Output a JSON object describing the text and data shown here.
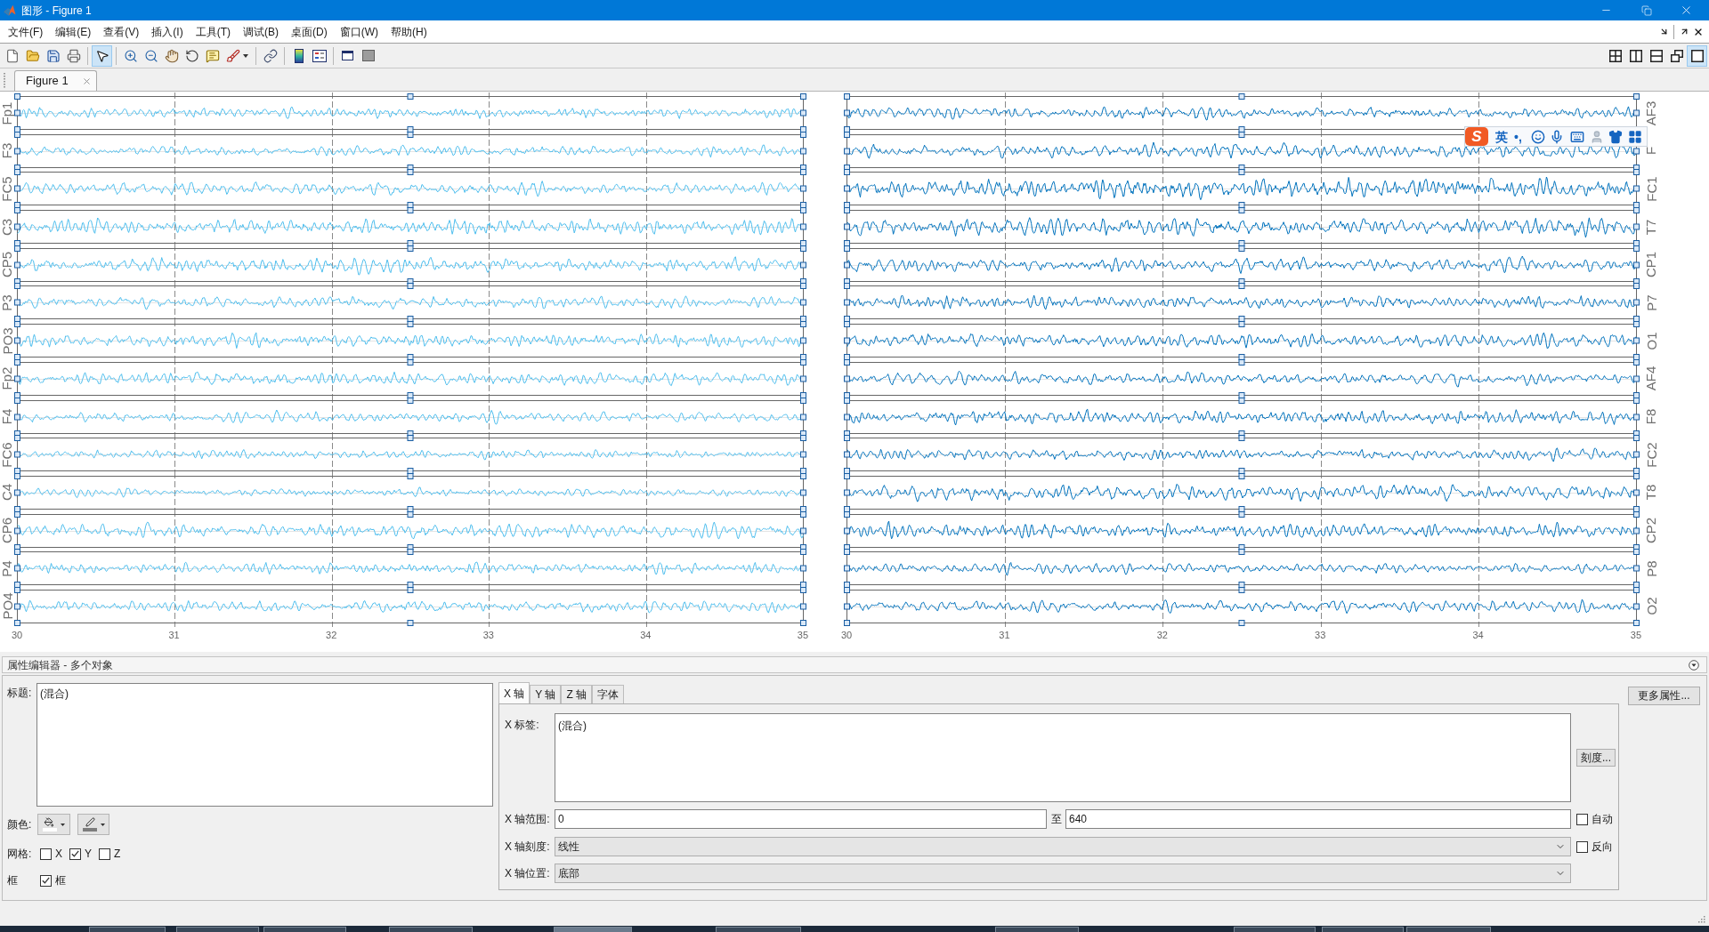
{
  "window": {
    "title": "图形 - Figure 1"
  },
  "menu": {
    "items": [
      "文件(F)",
      "编辑(E)",
      "查看(V)",
      "插入(I)",
      "工具(T)",
      "调试(B)",
      "桌面(D)",
      "窗口(W)",
      "帮助(H)"
    ]
  },
  "toolbar": {
    "tools": [
      {
        "selected": false
      },
      {
        "selected": false
      },
      {
        "selected": false
      },
      {
        "selected": false
      },
      {
        "selected": true
      },
      {
        "selected": false
      },
      {
        "selected": false
      },
      {
        "selected": false
      },
      {
        "selected": false
      },
      {
        "selected": false
      },
      {
        "selected": false
      },
      {
        "selected": false
      },
      {
        "selected": false
      },
      {
        "selected": false
      },
      {
        "selected": false
      },
      {
        "selected": false
      }
    ],
    "layouts": [
      {
        "selected": false
      },
      {
        "selected": false
      },
      {
        "selected": false
      },
      {
        "selected": false
      },
      {
        "selected": true
      }
    ]
  },
  "tabs": [
    {
      "label": "Figure 1",
      "selected": true
    }
  ],
  "figure": {
    "panels": [
      {
        "color": "#4dbeee",
        "channels": [
          "Fp1",
          "F3",
          "FC5",
          "C3",
          "CP5",
          "P3",
          "PO3",
          "Fp2",
          "F4",
          "FC6",
          "C4",
          "CP6",
          "P4",
          "PO4"
        ],
        "x_ticks": [
          "30",
          "31",
          "32",
          "33",
          "34",
          "35"
        ]
      },
      {
        "color": "#0072bd",
        "channels": [
          "AF3",
          "F",
          "FC1",
          "T7",
          "CP1",
          "P7",
          "O1",
          "AF4",
          "F8",
          "FC2",
          "T8",
          "CP2",
          "P8",
          "O2"
        ],
        "x_ticks": [
          "30",
          "31",
          "32",
          "33",
          "34",
          "35"
        ]
      }
    ]
  },
  "ime_toolbar": {
    "logo": "S",
    "mode": "英",
    "punctuation": "•,"
  },
  "property_editor": {
    "title": "属性编辑器 - 多个对象",
    "title_field": {
      "label": "标题:",
      "value": "(混合)"
    },
    "color_label": "颜色:",
    "grid": {
      "label": "网格:",
      "options": [
        {
          "label": "X",
          "checked": false
        },
        {
          "label": "Y",
          "checked": true
        },
        {
          "label": "Z",
          "checked": false
        }
      ]
    },
    "box": {
      "label": "框",
      "option": {
        "label": "框",
        "checked": true
      }
    },
    "tabs": [
      {
        "label": "X 轴",
        "selected": true
      },
      {
        "label": "Y 轴",
        "selected": false
      },
      {
        "label": "Z 轴",
        "selected": false
      },
      {
        "label": "字体",
        "selected": false
      }
    ],
    "x_label": {
      "label": "X 标签:",
      "value": "(混合)"
    },
    "ticks_button": "刻度...",
    "x_limits": {
      "label": "X 轴范围:",
      "from": "0",
      "separator": "至",
      "to": "640"
    },
    "auto": {
      "label": "自动",
      "checked": false
    },
    "x_scale": {
      "label": "X 轴刻度:",
      "value": "线性"
    },
    "reverse": {
      "label": "反向",
      "checked": false
    },
    "x_location": {
      "label": "X 轴位置:",
      "value": "底部"
    },
    "more_button": "更多属性..."
  },
  "taskbar": {
    "buttons": [
      {
        "selected": false
      },
      {
        "selected": false
      },
      {
        "selected": false
      },
      {
        "selected": false
      },
      {
        "selected": true
      },
      {
        "selected": false
      },
      {
        "selected": false
      },
      {
        "selected": false
      },
      {
        "selected": false
      },
      {
        "selected": false
      }
    ]
  }
}
